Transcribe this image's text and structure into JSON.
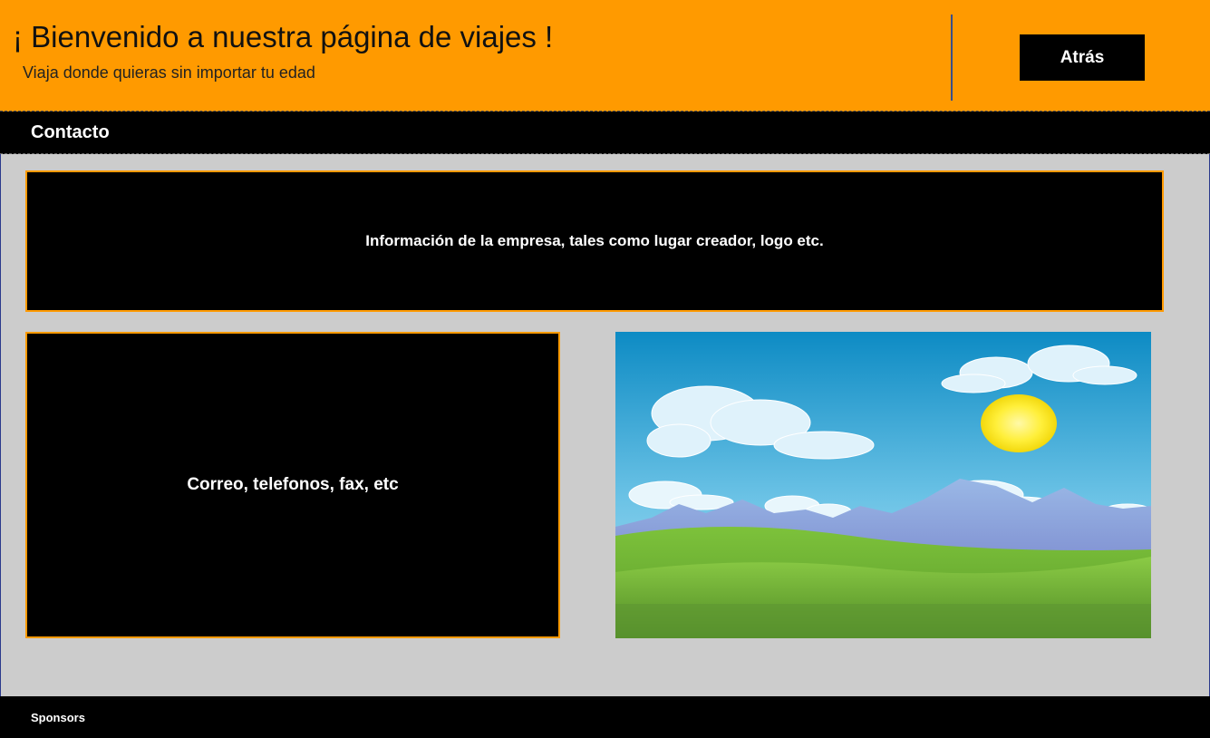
{
  "header": {
    "title": "¡ Bienvenido a nuestra página de viajes !",
    "subtitle": "Viaja donde quieras sin importar tu edad",
    "back_label": "Atrás",
    "background_color": "#ff9a00"
  },
  "nav": {
    "contact_label": "Contacto"
  },
  "main": {
    "company_info": "Información de la empresa, tales como lugar creador, logo etc.",
    "contact_info": "Correo, telefonos, fax, etc",
    "image_icon": "landscape-image"
  },
  "footer": {
    "sponsors_label": "Sponsors"
  }
}
